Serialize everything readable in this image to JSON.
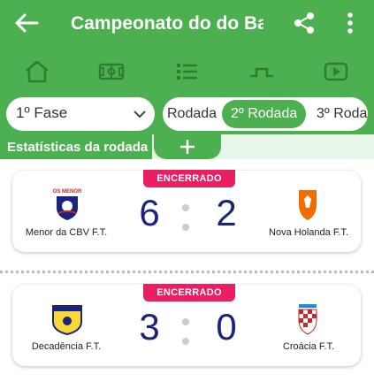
{
  "app": {
    "title": "Campeonato do do Bai",
    "bar_color": "#4caf50"
  },
  "icons": {
    "back": "arrow-left-icon",
    "share": "share-icon",
    "more": "more-vert-icon",
    "nav": [
      "home-icon",
      "field-icon",
      "list-icon",
      "bracket-icon",
      "video-icon"
    ]
  },
  "filters": {
    "phase_value": "1º Fase",
    "rounds": [
      "Rodada",
      "2º Rodada",
      "3º Roda"
    ],
    "active_round_index": 1
  },
  "stats": {
    "label": "Estatísticas da rodada",
    "add_label": "+"
  },
  "matches": [
    {
      "status": "ENCERRADO",
      "home": {
        "name": "Menor da CBV F.T.",
        "logo_text": "OS MENOR",
        "score": "6"
      },
      "away": {
        "name": "Nova Holanda F.T.",
        "score": "2"
      }
    },
    {
      "status": "ENCERRADO",
      "home": {
        "name": "Decadência F.T.",
        "score": "3"
      },
      "away": {
        "name": "Croácia F.T.",
        "score": "0"
      }
    }
  ]
}
